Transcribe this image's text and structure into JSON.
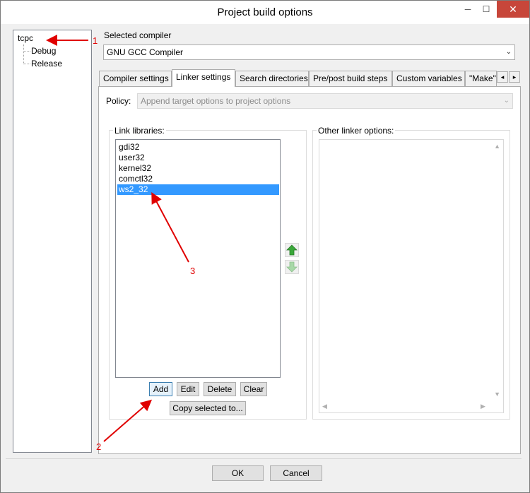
{
  "window": {
    "title": "Project build options",
    "minimize": "─",
    "maximize": "☐",
    "close": "✕"
  },
  "tree": {
    "root": "tcpc",
    "children": [
      "Debug",
      "Release"
    ]
  },
  "compiler": {
    "label": "Selected compiler",
    "value": "GNU GCC Compiler"
  },
  "tabs": [
    {
      "label": "Compiler settings",
      "active": false
    },
    {
      "label": "Linker settings",
      "active": true
    },
    {
      "label": "Search directories",
      "active": false
    },
    {
      "label": "Pre/post build steps",
      "active": false
    },
    {
      "label": "Custom variables",
      "active": false
    },
    {
      "label": "\"Make\"",
      "active": false
    }
  ],
  "tab_scroll": {
    "left": "◂",
    "right": "▸"
  },
  "policy": {
    "label": "Policy:",
    "value": "Append target options to project options"
  },
  "link_libraries": {
    "label": "Link libraries:",
    "items": [
      "gdi32",
      "user32",
      "kernel32",
      "comctl32",
      "ws2_32"
    ],
    "selected_index": 4,
    "buttons": {
      "add": "Add",
      "edit": "Edit",
      "delete": "Delete",
      "clear": "Clear",
      "copy": "Copy selected to..."
    }
  },
  "other_linker_options": {
    "label": "Other linker options:",
    "value": ""
  },
  "dialog_buttons": {
    "ok": "OK",
    "cancel": "Cancel"
  },
  "annotations": [
    "1",
    "2",
    "3"
  ],
  "colors": {
    "selection": "#3399ff",
    "annotation": "#e00000",
    "close_button": "#c7463a",
    "arrow_green": "#3aa83a"
  }
}
